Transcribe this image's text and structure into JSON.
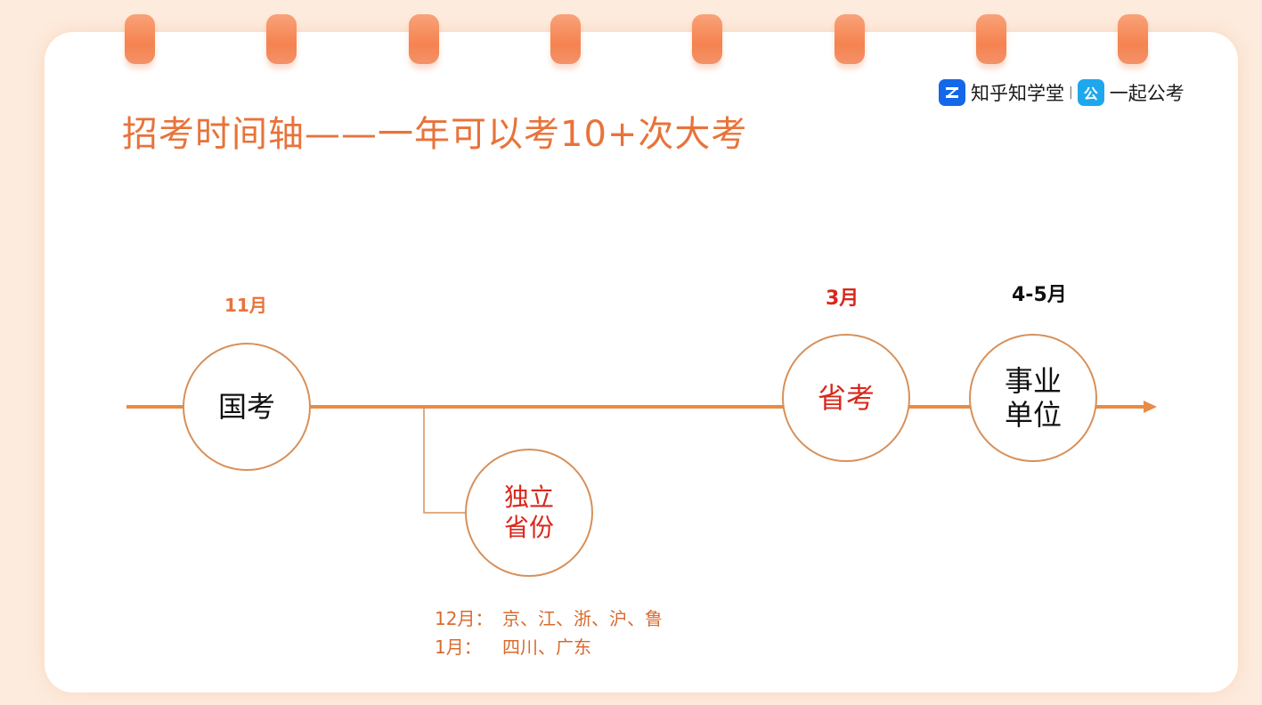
{
  "brand": {
    "zhihu_icon": "zhihu-logo-icon",
    "zhihu_name": "知乎知学堂",
    "separator": "|",
    "gong_icon": "公",
    "gong_name": "一起公考"
  },
  "title": "招考时间轴——一年可以考10+次大考",
  "timeline": {
    "nodes": [
      {
        "month": "11月",
        "line1": "国考",
        "line2": ""
      },
      {
        "month": "",
        "line1": "独立",
        "line2": "省份"
      },
      {
        "month": "3月",
        "line1": "省考",
        "line2": ""
      },
      {
        "month": "4-5月",
        "line1": "事业",
        "line2": "单位"
      }
    ],
    "notes": [
      {
        "month": "12月：",
        "places": "京、江、浙、沪、鲁"
      },
      {
        "month": "1月：",
        "places": "四川、广东"
      }
    ]
  },
  "colors": {
    "accent": "#e8733a",
    "line": "#e98a46",
    "circle_border": "#d7905a",
    "red_text": "#d8281c",
    "dark_text": "#111111",
    "ring": "#f5834f"
  }
}
